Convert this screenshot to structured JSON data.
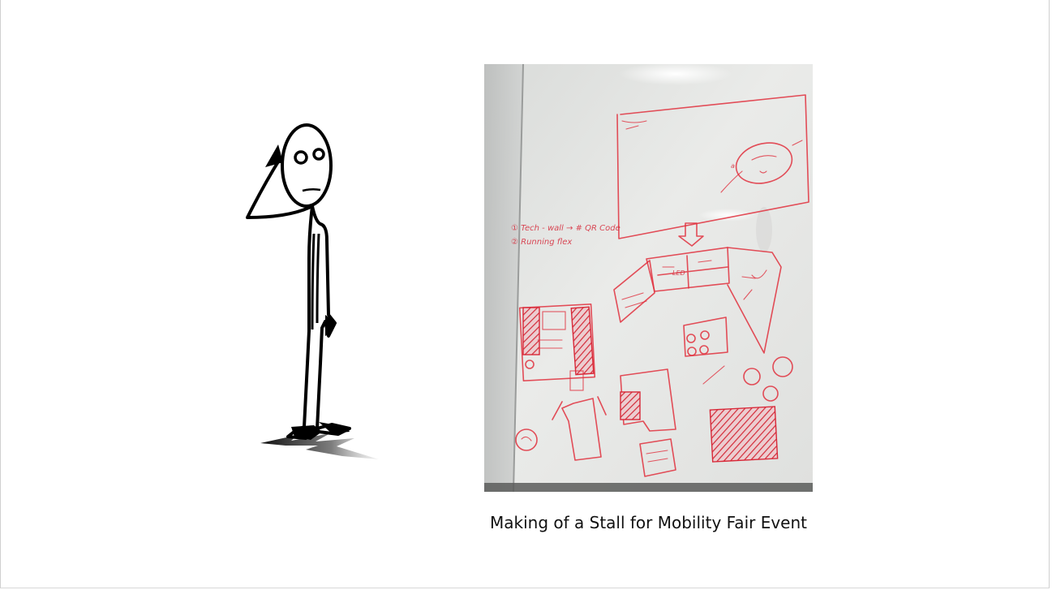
{
  "slide": {
    "caption": "Making of a Stall for Mobility Fair Event"
  },
  "illustration": {
    "icon": "stick-figure-thinking-icon"
  },
  "photo": {
    "icon": "whiteboard-sketch-photo",
    "board_notes": [
      "① Tech - wall → # QR Code",
      "② Running flex"
    ],
    "colors": {
      "marker": "#e0303d",
      "board": "#e8e9e7"
    }
  }
}
